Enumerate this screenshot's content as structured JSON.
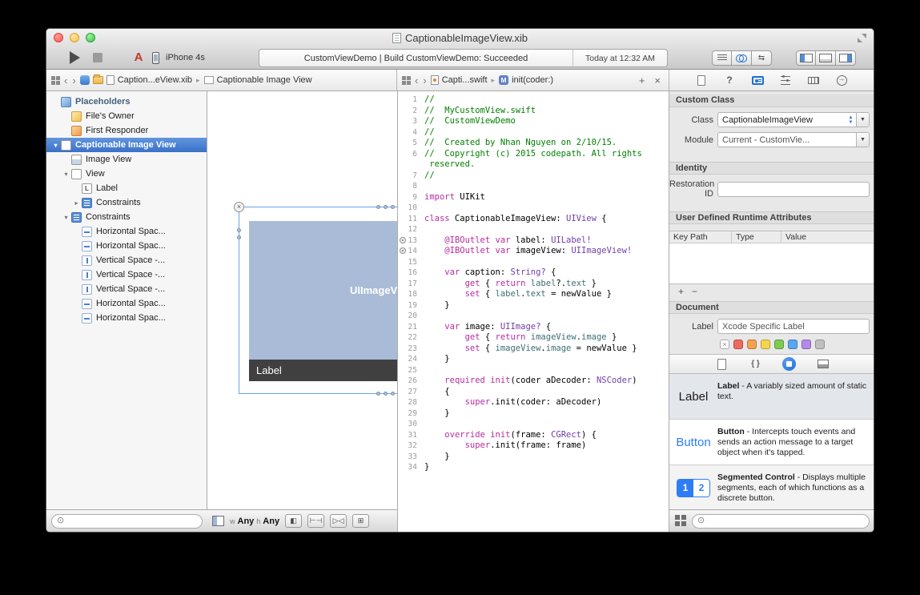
{
  "window": {
    "title": "CaptionableImageView.xib"
  },
  "toolbar": {
    "device": "iPhone 4s",
    "status_main": "CustomViewDemo | Build CustomViewDemo: Succeeded",
    "status_time": "Today at 12:32 AM"
  },
  "jumpbar_left": {
    "file": "Caption...eView.xib",
    "object": "Captionable Image View"
  },
  "jumpbar_right": {
    "file": "Capti...swift",
    "symbol": "init(coder:)",
    "symbol_badge": "M",
    "add_label": "+",
    "close_label": "×"
  },
  "sidebar": {
    "items": [
      {
        "label": "Placeholders",
        "level": 0,
        "icon": "cube-blue",
        "group": true
      },
      {
        "label": "File's Owner",
        "level": 1,
        "icon": "cube-yellow"
      },
      {
        "label": "First Responder",
        "level": 1,
        "icon": "cube-orange"
      },
      {
        "label": "Captionable Image View",
        "level": 0,
        "icon": "view",
        "disclosure": "open",
        "selected": true
      },
      {
        "label": "Image View",
        "level": 1,
        "icon": "imageview"
      },
      {
        "label": "View",
        "level": 1,
        "icon": "view",
        "disclosure": "open"
      },
      {
        "label": "Label",
        "level": 2,
        "icon": "label"
      },
      {
        "label": "Constraints",
        "level": 2,
        "icon": "constraints",
        "disclosure": "closed"
      },
      {
        "label": "Constraints",
        "level": 1,
        "icon": "constraints",
        "disclosure": "open"
      },
      {
        "label": "Horizontal Spac...",
        "level": 2,
        "icon": "constraint-h"
      },
      {
        "label": "Horizontal Spac...",
        "level": 2,
        "icon": "constraint-h"
      },
      {
        "label": "Vertical Space -...",
        "level": 2,
        "icon": "constraint-v"
      },
      {
        "label": "Vertical Space -...",
        "level": 2,
        "icon": "constraint-v"
      },
      {
        "label": "Vertical Space -...",
        "level": 2,
        "icon": "constraint-v"
      },
      {
        "label": "Horizontal Spac...",
        "level": 2,
        "icon": "constraint-h"
      },
      {
        "label": "Horizontal Spac...",
        "level": 2,
        "icon": "constraint-h"
      }
    ]
  },
  "canvas": {
    "imageview_label": "UIImageView",
    "label_text": "Label",
    "size_bar": {
      "w_key": "w",
      "w_val": "Any",
      "h_key": "h",
      "h_val": "Any"
    }
  },
  "code": {
    "lines": [
      {
        "n": "1",
        "s": [
          [
            "cm",
            "//"
          ]
        ]
      },
      {
        "n": "2",
        "s": [
          [
            "cm",
            "//  MyCustomView.swift"
          ]
        ]
      },
      {
        "n": "3",
        "s": [
          [
            "cm",
            "//  CustomViewDemo"
          ]
        ]
      },
      {
        "n": "4",
        "s": [
          [
            "cm",
            "//"
          ]
        ]
      },
      {
        "n": "5",
        "s": [
          [
            "cm",
            "//  Created by Nhan Nguyen on 2/10/15."
          ]
        ]
      },
      {
        "n": "6",
        "s": [
          [
            "cm",
            "//  Copyright (c) 2015 codepath. All rights"
          ]
        ]
      },
      {
        "n": "",
        "s": [
          [
            "cm",
            " reserved."
          ]
        ]
      },
      {
        "n": "7",
        "s": [
          [
            "cm",
            "//"
          ]
        ]
      },
      {
        "n": "8",
        "s": []
      },
      {
        "n": "9",
        "s": [
          [
            "kw",
            "import"
          ],
          [
            "pl",
            " UIKit"
          ]
        ]
      },
      {
        "n": "10",
        "s": []
      },
      {
        "n": "11",
        "s": [
          [
            "kw",
            "class"
          ],
          [
            "pl",
            " CaptionableImageView: "
          ],
          [
            "ty",
            "UIView"
          ],
          [
            "pl",
            " {"
          ]
        ]
      },
      {
        "n": "12",
        "s": []
      },
      {
        "n": "13",
        "m": true,
        "s": [
          [
            "pl",
            "    "
          ],
          [
            "kw",
            "@IBOutlet"
          ],
          [
            "pl",
            " "
          ],
          [
            "kw",
            "var"
          ],
          [
            "pl",
            " label: "
          ],
          [
            "ty",
            "UILabel!"
          ]
        ]
      },
      {
        "n": "14",
        "m": true,
        "s": [
          [
            "pl",
            "    "
          ],
          [
            "kw",
            "@IBOutlet"
          ],
          [
            "pl",
            " "
          ],
          [
            "kw",
            "var"
          ],
          [
            "pl",
            " imageView: "
          ],
          [
            "ty",
            "UIImageView!"
          ]
        ]
      },
      {
        "n": "15",
        "s": []
      },
      {
        "n": "16",
        "s": [
          [
            "pl",
            "    "
          ],
          [
            "kw",
            "var"
          ],
          [
            "pl",
            " caption: "
          ],
          [
            "ty",
            "String?"
          ],
          [
            "pl",
            " {"
          ]
        ]
      },
      {
        "n": "17",
        "s": [
          [
            "pl",
            "        "
          ],
          [
            "kw",
            "get"
          ],
          [
            "pl",
            " { "
          ],
          [
            "kw",
            "return"
          ],
          [
            "pl",
            " "
          ],
          [
            "tl2",
            "label"
          ],
          [
            "pl",
            "?."
          ],
          [
            "tl2",
            "text"
          ],
          [
            "pl",
            " }"
          ]
        ]
      },
      {
        "n": "18",
        "s": [
          [
            "pl",
            "        "
          ],
          [
            "kw",
            "set"
          ],
          [
            "pl",
            " { "
          ],
          [
            "tl2",
            "label"
          ],
          [
            "pl",
            "."
          ],
          [
            "tl2",
            "text"
          ],
          [
            "pl",
            " = newValue }"
          ]
        ]
      },
      {
        "n": "19",
        "s": [
          [
            "pl",
            "    }"
          ]
        ]
      },
      {
        "n": "20",
        "s": []
      },
      {
        "n": "21",
        "s": [
          [
            "pl",
            "    "
          ],
          [
            "kw",
            "var"
          ],
          [
            "pl",
            " image: "
          ],
          [
            "ty",
            "UIImage?"
          ],
          [
            "pl",
            " {"
          ]
        ]
      },
      {
        "n": "22",
        "s": [
          [
            "pl",
            "        "
          ],
          [
            "kw",
            "get"
          ],
          [
            "pl",
            " { "
          ],
          [
            "kw",
            "return"
          ],
          [
            "pl",
            " "
          ],
          [
            "tl2",
            "imageView"
          ],
          [
            "pl",
            "."
          ],
          [
            "tl2",
            "image"
          ],
          [
            "pl",
            " }"
          ]
        ]
      },
      {
        "n": "23",
        "s": [
          [
            "pl",
            "        "
          ],
          [
            "kw",
            "set"
          ],
          [
            "pl",
            " { "
          ],
          [
            "tl2",
            "imageView"
          ],
          [
            "pl",
            "."
          ],
          [
            "tl2",
            "image"
          ],
          [
            "pl",
            " = newValue }"
          ]
        ]
      },
      {
        "n": "24",
        "s": [
          [
            "pl",
            "    }"
          ]
        ]
      },
      {
        "n": "25",
        "s": []
      },
      {
        "n": "26",
        "s": [
          [
            "pl",
            "    "
          ],
          [
            "kw",
            "required"
          ],
          [
            "pl",
            " "
          ],
          [
            "kw",
            "init"
          ],
          [
            "pl",
            "(coder aDecoder: "
          ],
          [
            "ty",
            "NSCoder"
          ],
          [
            "pl",
            ")"
          ]
        ]
      },
      {
        "n": "27",
        "s": [
          [
            "pl",
            "    {"
          ]
        ]
      },
      {
        "n": "28",
        "s": [
          [
            "pl",
            "        "
          ],
          [
            "kw",
            "super"
          ],
          [
            "pl",
            ".init(coder: aDecoder)"
          ]
        ]
      },
      {
        "n": "29",
        "s": [
          [
            "pl",
            "    }"
          ]
        ]
      },
      {
        "n": "30",
        "s": []
      },
      {
        "n": "31",
        "s": [
          [
            "pl",
            "    "
          ],
          [
            "kw",
            "override"
          ],
          [
            "pl",
            " "
          ],
          [
            "kw",
            "init"
          ],
          [
            "pl",
            "(frame: "
          ],
          [
            "ty",
            "CGRect"
          ],
          [
            "pl",
            ") {"
          ]
        ]
      },
      {
        "n": "32",
        "s": [
          [
            "pl",
            "        "
          ],
          [
            "kw",
            "super"
          ],
          [
            "pl",
            ".init(frame: frame)"
          ]
        ]
      },
      {
        "n": "33",
        "s": [
          [
            "pl",
            "    }"
          ]
        ]
      },
      {
        "n": "34",
        "s": [
          [
            "pl",
            "}"
          ]
        ]
      }
    ]
  },
  "inspector": {
    "custom_class": {
      "title": "Custom Class",
      "class_label": "Class",
      "class_value": "CaptionableImageView",
      "module_label": "Module",
      "module_value": "Current - CustomVie..."
    },
    "identity": {
      "title": "Identity",
      "restoration_label": "Restoration ID",
      "restoration_value": ""
    },
    "runtime_attrs": {
      "title": "User Defined Runtime Attributes",
      "columns": [
        "Key Path",
        "Type",
        "Value"
      ],
      "add_label": "+",
      "remove_label": "−"
    },
    "document": {
      "title": "Document",
      "label_label": "Label",
      "label_value": "Xcode Specific Label",
      "colors": [
        "#ee6a5f",
        "#f5a14f",
        "#f8d44c",
        "#7ecb52",
        "#59a6f2",
        "#b38ae8",
        "#c0c0c0"
      ]
    },
    "library": {
      "items": [
        {
          "icon": "label",
          "icon_text": "Label",
          "title": "Label",
          "desc": " - A variably sized amount of static text."
        },
        {
          "icon": "button",
          "icon_text": "Button",
          "title": "Button",
          "desc": " - Intercepts touch events and sends an action message to a target object when it's tapped."
        },
        {
          "icon": "segmented",
          "seg1": "1",
          "seg2": "2",
          "title": "Segmented Control",
          "desc": " - Displays multiple segments, each of which functions as a discrete button."
        }
      ]
    }
  }
}
